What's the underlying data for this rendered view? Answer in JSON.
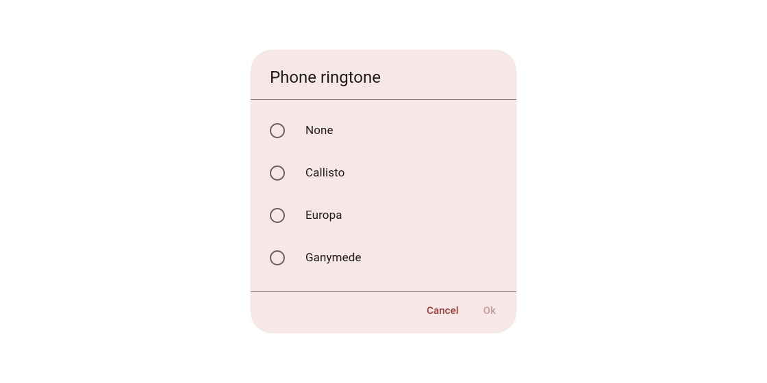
{
  "dialog": {
    "title": "Phone ringtone",
    "options": [
      {
        "label": "None"
      },
      {
        "label": "Callisto"
      },
      {
        "label": "Europa"
      },
      {
        "label": "Ganymede"
      }
    ],
    "cancel_label": "Cancel",
    "ok_label": "Ok"
  }
}
